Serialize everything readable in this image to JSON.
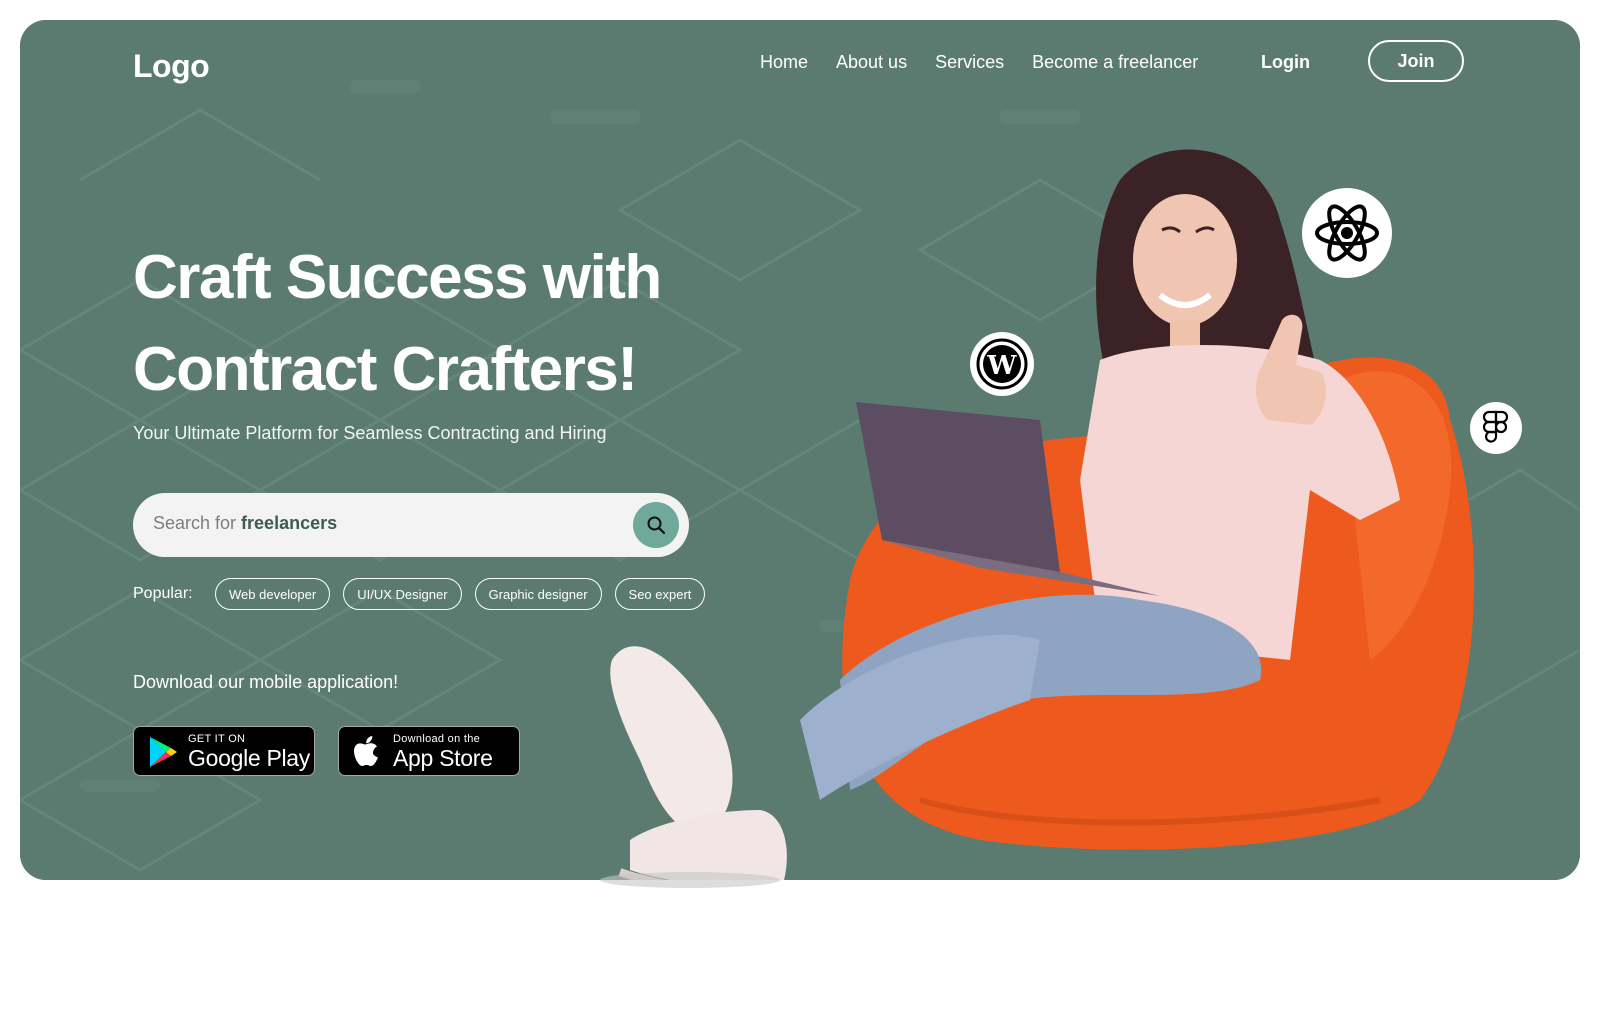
{
  "nav": {
    "logo": "Logo",
    "links": [
      "Home",
      "About us",
      "Services",
      "Become a freelancer"
    ],
    "login": "Login",
    "join": "Join"
  },
  "hero": {
    "headline_line1": "Craft Success with",
    "headline_line2": "Contract Crafters!",
    "subtitle": "Your Ultimate Platform for Seamless Contracting and Hiring"
  },
  "search": {
    "placeholder_prefix": "Search for ",
    "placeholder_keyword": "freelancers",
    "button_icon": "search-icon"
  },
  "popular": {
    "label": "Popular:",
    "chips": [
      "Web developer",
      "UI/UX Designer",
      "Graphic designer",
      "Seo expert"
    ]
  },
  "download": {
    "label": "Download our mobile application!",
    "google_small": "GET IT ON",
    "google_big": "Google Play",
    "apple_small": "Download on the",
    "apple_big": "App Store"
  },
  "badges": [
    "react-icon",
    "wordpress-icon",
    "figma-icon"
  ],
  "colors": {
    "hero_bg": "#5b7b70",
    "search_button": "#6fa99a",
    "beanbag": "#ee5a1e",
    "shirt": "#f6d6d4",
    "jeans": "#8fa3c3"
  }
}
